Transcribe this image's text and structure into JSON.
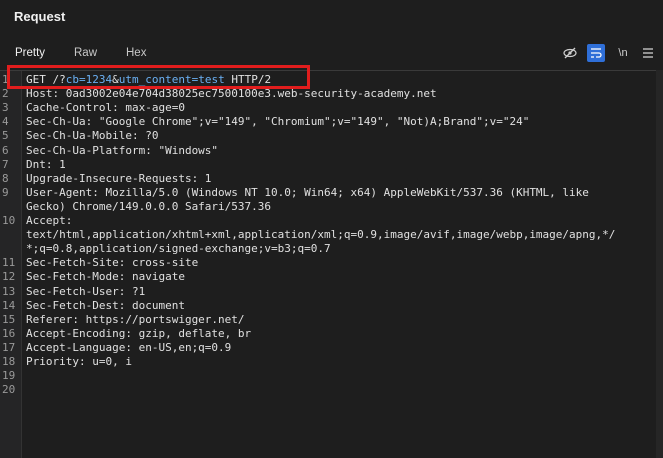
{
  "panel": {
    "title": "Request"
  },
  "tabs": [
    {
      "label": "Pretty",
      "active": true
    },
    {
      "label": "Raw",
      "active": false
    },
    {
      "label": "Hex",
      "active": false
    }
  ],
  "toolbar": {
    "icons": [
      "eye-off-icon",
      "wrap-icon",
      "newline-icon",
      "menu-icon"
    ],
    "newline_label": "\\n"
  },
  "request_line": {
    "method": "GET",
    "path_prefix": "/?",
    "param1_name": "cb",
    "param1_value": "1234",
    "amp": "&",
    "param2_name": "utm_content",
    "param2_value": "test",
    "protocol": "HTTP/2"
  },
  "lines": [
    {
      "n": "1",
      "text": ""
    },
    {
      "n": "2",
      "text": "Host: 0ad3002e04e704d38025ec7500100e3.web-security-academy.net"
    },
    {
      "n": "3",
      "text": "Cache-Control: max-age=0"
    },
    {
      "n": "4",
      "text": "Sec-Ch-Ua: \"Google Chrome\";v=\"149\", \"Chromium\";v=\"149\", \"Not)A;Brand\";v=\"24\""
    },
    {
      "n": "5",
      "text": "Sec-Ch-Ua-Mobile: ?0"
    },
    {
      "n": "6",
      "text": "Sec-Ch-Ua-Platform: \"Windows\""
    },
    {
      "n": "7",
      "text": "Dnt: 1"
    },
    {
      "n": "8",
      "text": "Upgrade-Insecure-Requests: 1"
    },
    {
      "n": "9",
      "text": "User-Agent: Mozilla/5.0 (Windows NT 10.0; Win64; x64) AppleWebKit/537.36 (KHTML, like"
    },
    {
      "n": "",
      "text": "Gecko) Chrome/149.0.0.0 Safari/537.36"
    },
    {
      "n": "10",
      "text": "Accept:"
    },
    {
      "n": "",
      "text": "text/html,application/xhtml+xml,application/xml;q=0.9,image/avif,image/webp,image/apng,*/"
    },
    {
      "n": "",
      "text": "*;q=0.8,application/signed-exchange;v=b3;q=0.7"
    },
    {
      "n": "11",
      "text": "Sec-Fetch-Site: cross-site"
    },
    {
      "n": "12",
      "text": "Sec-Fetch-Mode: navigate"
    },
    {
      "n": "13",
      "text": "Sec-Fetch-User: ?1"
    },
    {
      "n": "14",
      "text": "Sec-Fetch-Dest: document"
    },
    {
      "n": "15",
      "text": "Referer: https://portswigger.net/"
    },
    {
      "n": "16",
      "text": "Accept-Encoding: gzip, deflate, br"
    },
    {
      "n": "17",
      "text": "Accept-Language: en-US,en;q=0.9"
    },
    {
      "n": "18",
      "text": "Priority: u=0, i"
    },
    {
      "n": "19",
      "text": ""
    },
    {
      "n": "20",
      "text": ""
    }
  ],
  "colors": {
    "background": "#1e1e1e",
    "highlight_box": "#e11d1d",
    "param_color": "#6ab0f3",
    "active_icon_bg": "#2f6fd8"
  }
}
